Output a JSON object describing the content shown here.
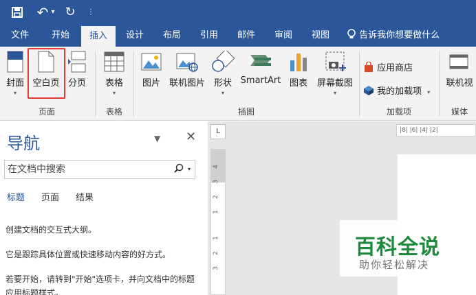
{
  "qat": {
    "save": "🖫",
    "undo": "↶",
    "undo_caret": "▾",
    "redo": "↻",
    "customize": "⫶"
  },
  "tabs": [
    "文件",
    "开始",
    "插入",
    "设计",
    "布局",
    "引用",
    "邮件",
    "审阅",
    "视图"
  ],
  "active_tab": "插入",
  "tell_me": "告诉我你想要做什么",
  "ribbon": {
    "cover": "封面",
    "blank_page": "空白页",
    "page_break": "分页",
    "table": "表格",
    "picture": "图片",
    "online_picture": "联机图片",
    "shapes": "形状",
    "smartart": "SmartArt",
    "chart": "图表",
    "screenshot": "屏幕截图",
    "app_store": "应用商店",
    "my_addins": "我的加载项",
    "online_video": "联机视",
    "groups": {
      "pages": "页面",
      "tables": "表格",
      "illustrations": "插图",
      "addins": "加载项",
      "media": "媒体"
    }
  },
  "nav": {
    "title": "导航",
    "search_placeholder": "在文档中搜索",
    "tabs": [
      "标题",
      "页面",
      "结果"
    ],
    "text1": "创建文档的交互式大纲。",
    "text2": "它是跟踪具体位置或快速移动内容的好方式。",
    "text3": "若要开始，请转到\"开始\"选项卡，并向文档中的标题应用标题样式。"
  },
  "ruler": {
    "corner": "L",
    "h_ticks": "|8| |6| |4| |2|",
    "v_nums": [
      "4",
      "3",
      "2",
      "1",
      "1",
      "2",
      "3"
    ]
  },
  "watermark": {
    "main": "百科全说",
    "sub": "助你轻松解决"
  }
}
